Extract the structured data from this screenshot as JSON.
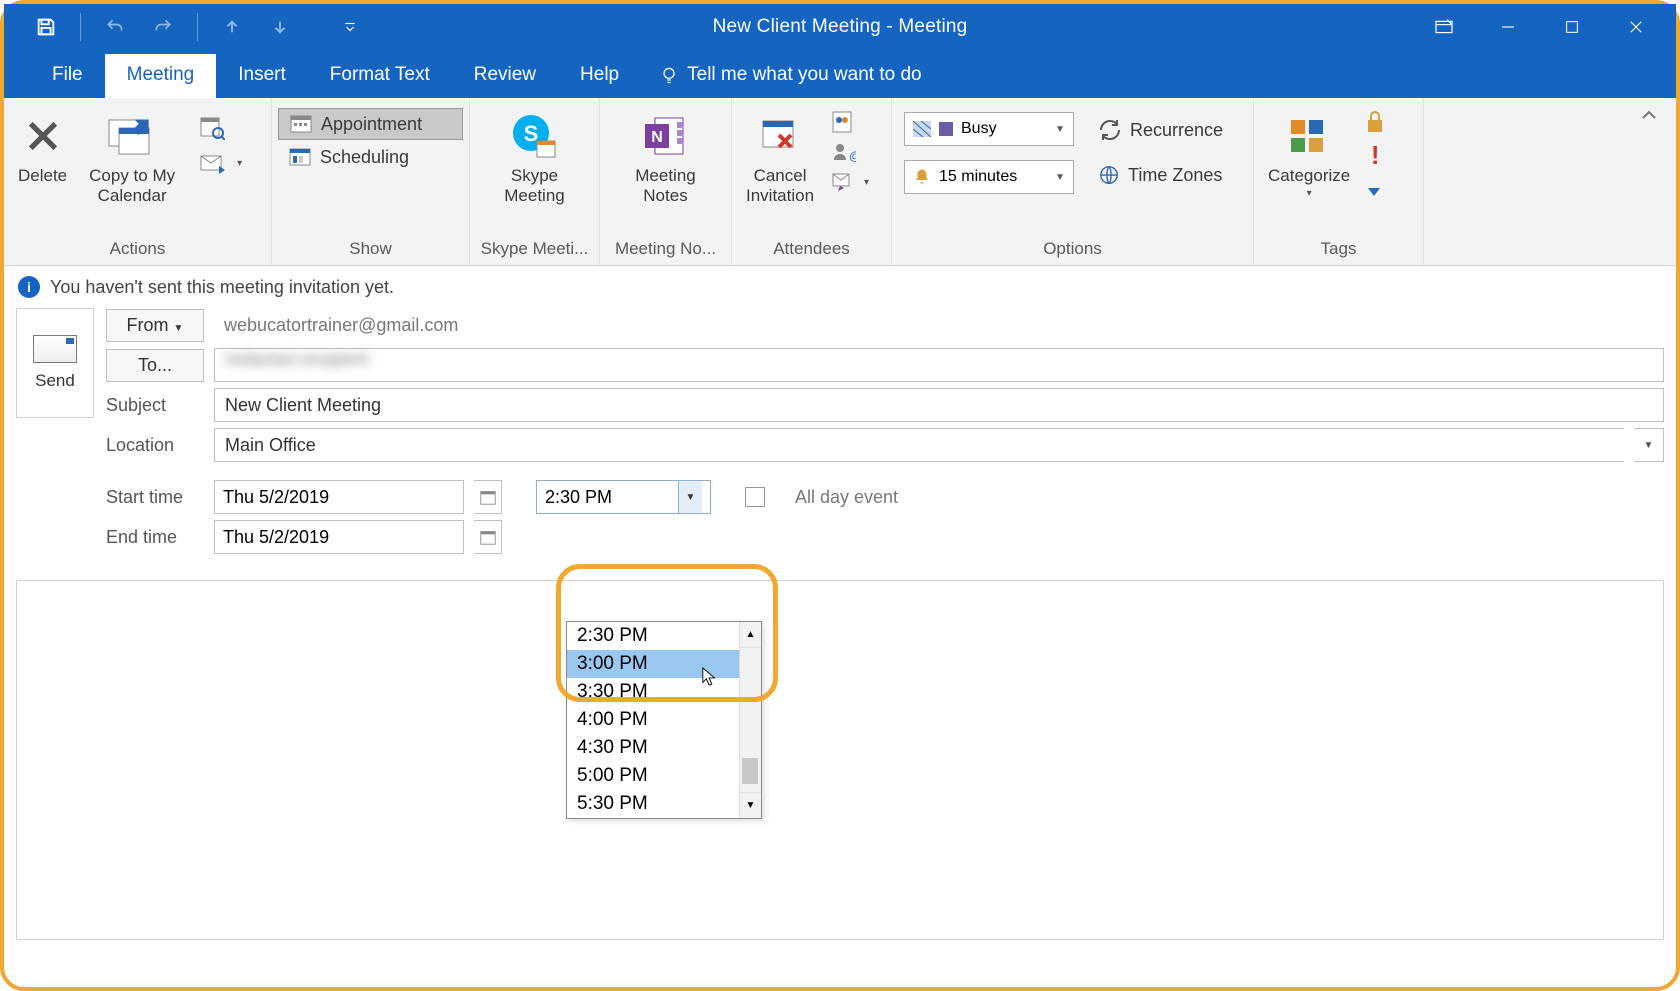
{
  "window": {
    "title": "New Client Meeting  -  Meeting"
  },
  "tabs": {
    "file": "File",
    "meeting": "Meeting",
    "insert": "Insert",
    "formatText": "Format Text",
    "review": "Review",
    "help": "Help",
    "tellMe": "Tell me what you want to do"
  },
  "ribbon": {
    "actions": {
      "delete": "Delete",
      "copyToMyCalendar": "Copy to My\nCalendar",
      "groupLabel": "Actions"
    },
    "show": {
      "appointment": "Appointment",
      "scheduling": "Scheduling",
      "groupLabel": "Show"
    },
    "skype": {
      "btn": "Skype\nMeeting",
      "groupLabel": "Skype Meeti..."
    },
    "meetingNotes": {
      "btn": "Meeting\nNotes",
      "groupLabel": "Meeting No..."
    },
    "attendees": {
      "cancel": "Cancel\nInvitation",
      "groupLabel": "Attendees"
    },
    "options": {
      "busy": "Busy",
      "reminder": "15 minutes",
      "recurrence": "Recurrence",
      "timeZones": "Time Zones",
      "groupLabel": "Options"
    },
    "tags": {
      "categorize": "Categorize",
      "groupLabel": "Tags"
    }
  },
  "infobar": "You haven't sent this meeting invitation yet.",
  "form": {
    "send": "Send",
    "fromLabel": "From",
    "fromValue": "webucatortrainer@gmail.com",
    "toLabel": "To...",
    "toValue": "redacted recipient",
    "subjectLabel": "Subject",
    "subjectValue": "New Client Meeting",
    "locationLabel": "Location",
    "locationValue": "Main Office",
    "startTimeLabel": "Start time",
    "startDate": "Thu 5/2/2019",
    "startTime": "2:30 PM",
    "endTimeLabel": "End time",
    "endDate": "Thu 5/2/2019",
    "allDay": "All day event"
  },
  "timeOptions": [
    "2:30 PM",
    "3:00 PM",
    "3:30 PM",
    "4:00 PM",
    "4:30 PM",
    "5:00 PM",
    "5:30 PM"
  ],
  "timeHoverIndex": 1
}
